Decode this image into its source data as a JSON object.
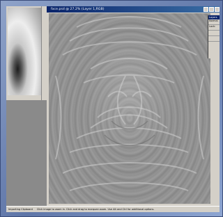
{
  "canvas_window": {
    "title": "face.psd @ 27.2% (Layer 1,RGB)"
  },
  "layers_palette": {
    "title": "Layers",
    "blend_mode": "Normal",
    "lock_label": "Lock:"
  },
  "status_bar": {
    "segment_1": "Importing Clipboard",
    "segment_2": "Click image to zoom in. Click and drag to marquee zoom. Use Alt and Ctrl for additional options."
  },
  "colors": {
    "titlebar": "#0a246a",
    "canvas_gray": "#8e8e8e",
    "frame_blue": "#5f76a8"
  }
}
